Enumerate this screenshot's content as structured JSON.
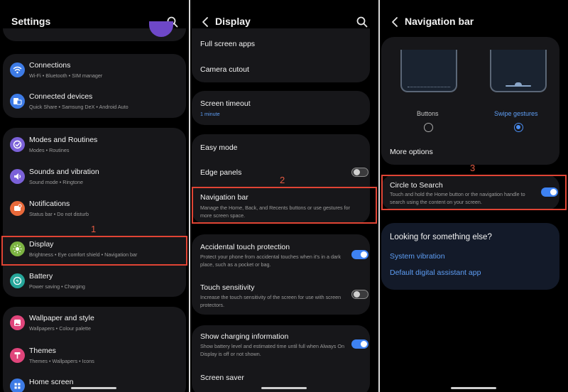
{
  "settings": {
    "title": "Settings",
    "items": [
      {
        "title": "Connections",
        "sub": "Wi-Fi  •  Bluetooth  •  SIM manager",
        "icon": "wifi-icon",
        "color": "#3d7be6"
      },
      {
        "title": "Connected devices",
        "sub": "Quick Share  •  Samsung DeX  •  Android Auto",
        "icon": "devices-icon",
        "color": "#3d7be6"
      },
      {
        "title": "Modes and Routines",
        "sub": "Modes  •  Routines",
        "icon": "modes-icon",
        "color": "#7b61d8"
      },
      {
        "title": "Sounds and vibration",
        "sub": "Sound mode  •  Ringtone",
        "icon": "sound-icon",
        "color": "#7b61d8"
      },
      {
        "title": "Notifications",
        "sub": "Status bar  •  Do not disturb",
        "icon": "notifications-icon",
        "color": "#e8693a"
      },
      {
        "title": "Display",
        "sub": "Brightness  •  Eye comfort shield  •  Navigation bar",
        "icon": "display-icon",
        "color": "#7cb342"
      },
      {
        "title": "Battery",
        "sub": "Power saving  •  Charging",
        "icon": "battery-icon",
        "color": "#26a69a"
      },
      {
        "title": "Wallpaper and style",
        "sub": "Wallpapers  •  Colour palette",
        "icon": "wallpaper-icon",
        "color": "#e0457b"
      },
      {
        "title": "Themes",
        "sub": "Themes  •  Wallpapers  •  Icons",
        "icon": "themes-icon",
        "color": "#e0457b"
      },
      {
        "title": "Home screen",
        "sub": "",
        "icon": "home-icon",
        "color": "#3d7be6"
      }
    ]
  },
  "display": {
    "title": "Display",
    "full_screen_apps": "Full screen apps",
    "camera_cutout": "Camera cutout",
    "screen_timeout": {
      "title": "Screen timeout",
      "value": "1 minute"
    },
    "easy_mode": "Easy mode",
    "edge_panels": {
      "title": "Edge panels",
      "on": false
    },
    "navigation_bar": {
      "title": "Navigation bar",
      "desc": "Manage the Home, Back, and Recents buttons or use gestures for more screen space."
    },
    "accidental_touch": {
      "title": "Accidental touch protection",
      "desc": "Protect your phone from accidental touches when it's in a dark place, such as a pocket or bag.",
      "on": true
    },
    "touch_sensitivity": {
      "title": "Touch sensitivity",
      "desc": "Increase the touch sensitivity of the screen for use with screen protectors.",
      "on": false
    },
    "charging_info": {
      "title": "Show charging information",
      "desc": "Show battery level and estimated time until full when Always On Display is off or not shown.",
      "on": true
    },
    "screen_saver": "Screen saver"
  },
  "navbar": {
    "title": "Navigation bar",
    "option_buttons": "Buttons",
    "option_gestures": "Swipe gestures",
    "selected": "Swipe gestures",
    "more_options": "More options",
    "circle": {
      "title": "Circle to Search",
      "desc": "Touch and hold the Home button or the navigation handle to search using the content on your screen.",
      "on": true
    },
    "looking": {
      "title": "Looking for something else?",
      "links": [
        "System vibration",
        "Default digital assistant app"
      ]
    }
  },
  "steps": [
    "1",
    "2",
    "3"
  ],
  "colors": {
    "accent": "#3e82f2",
    "highlight": "#e04434",
    "link": "#5e9ef5",
    "card": "#17171a"
  }
}
